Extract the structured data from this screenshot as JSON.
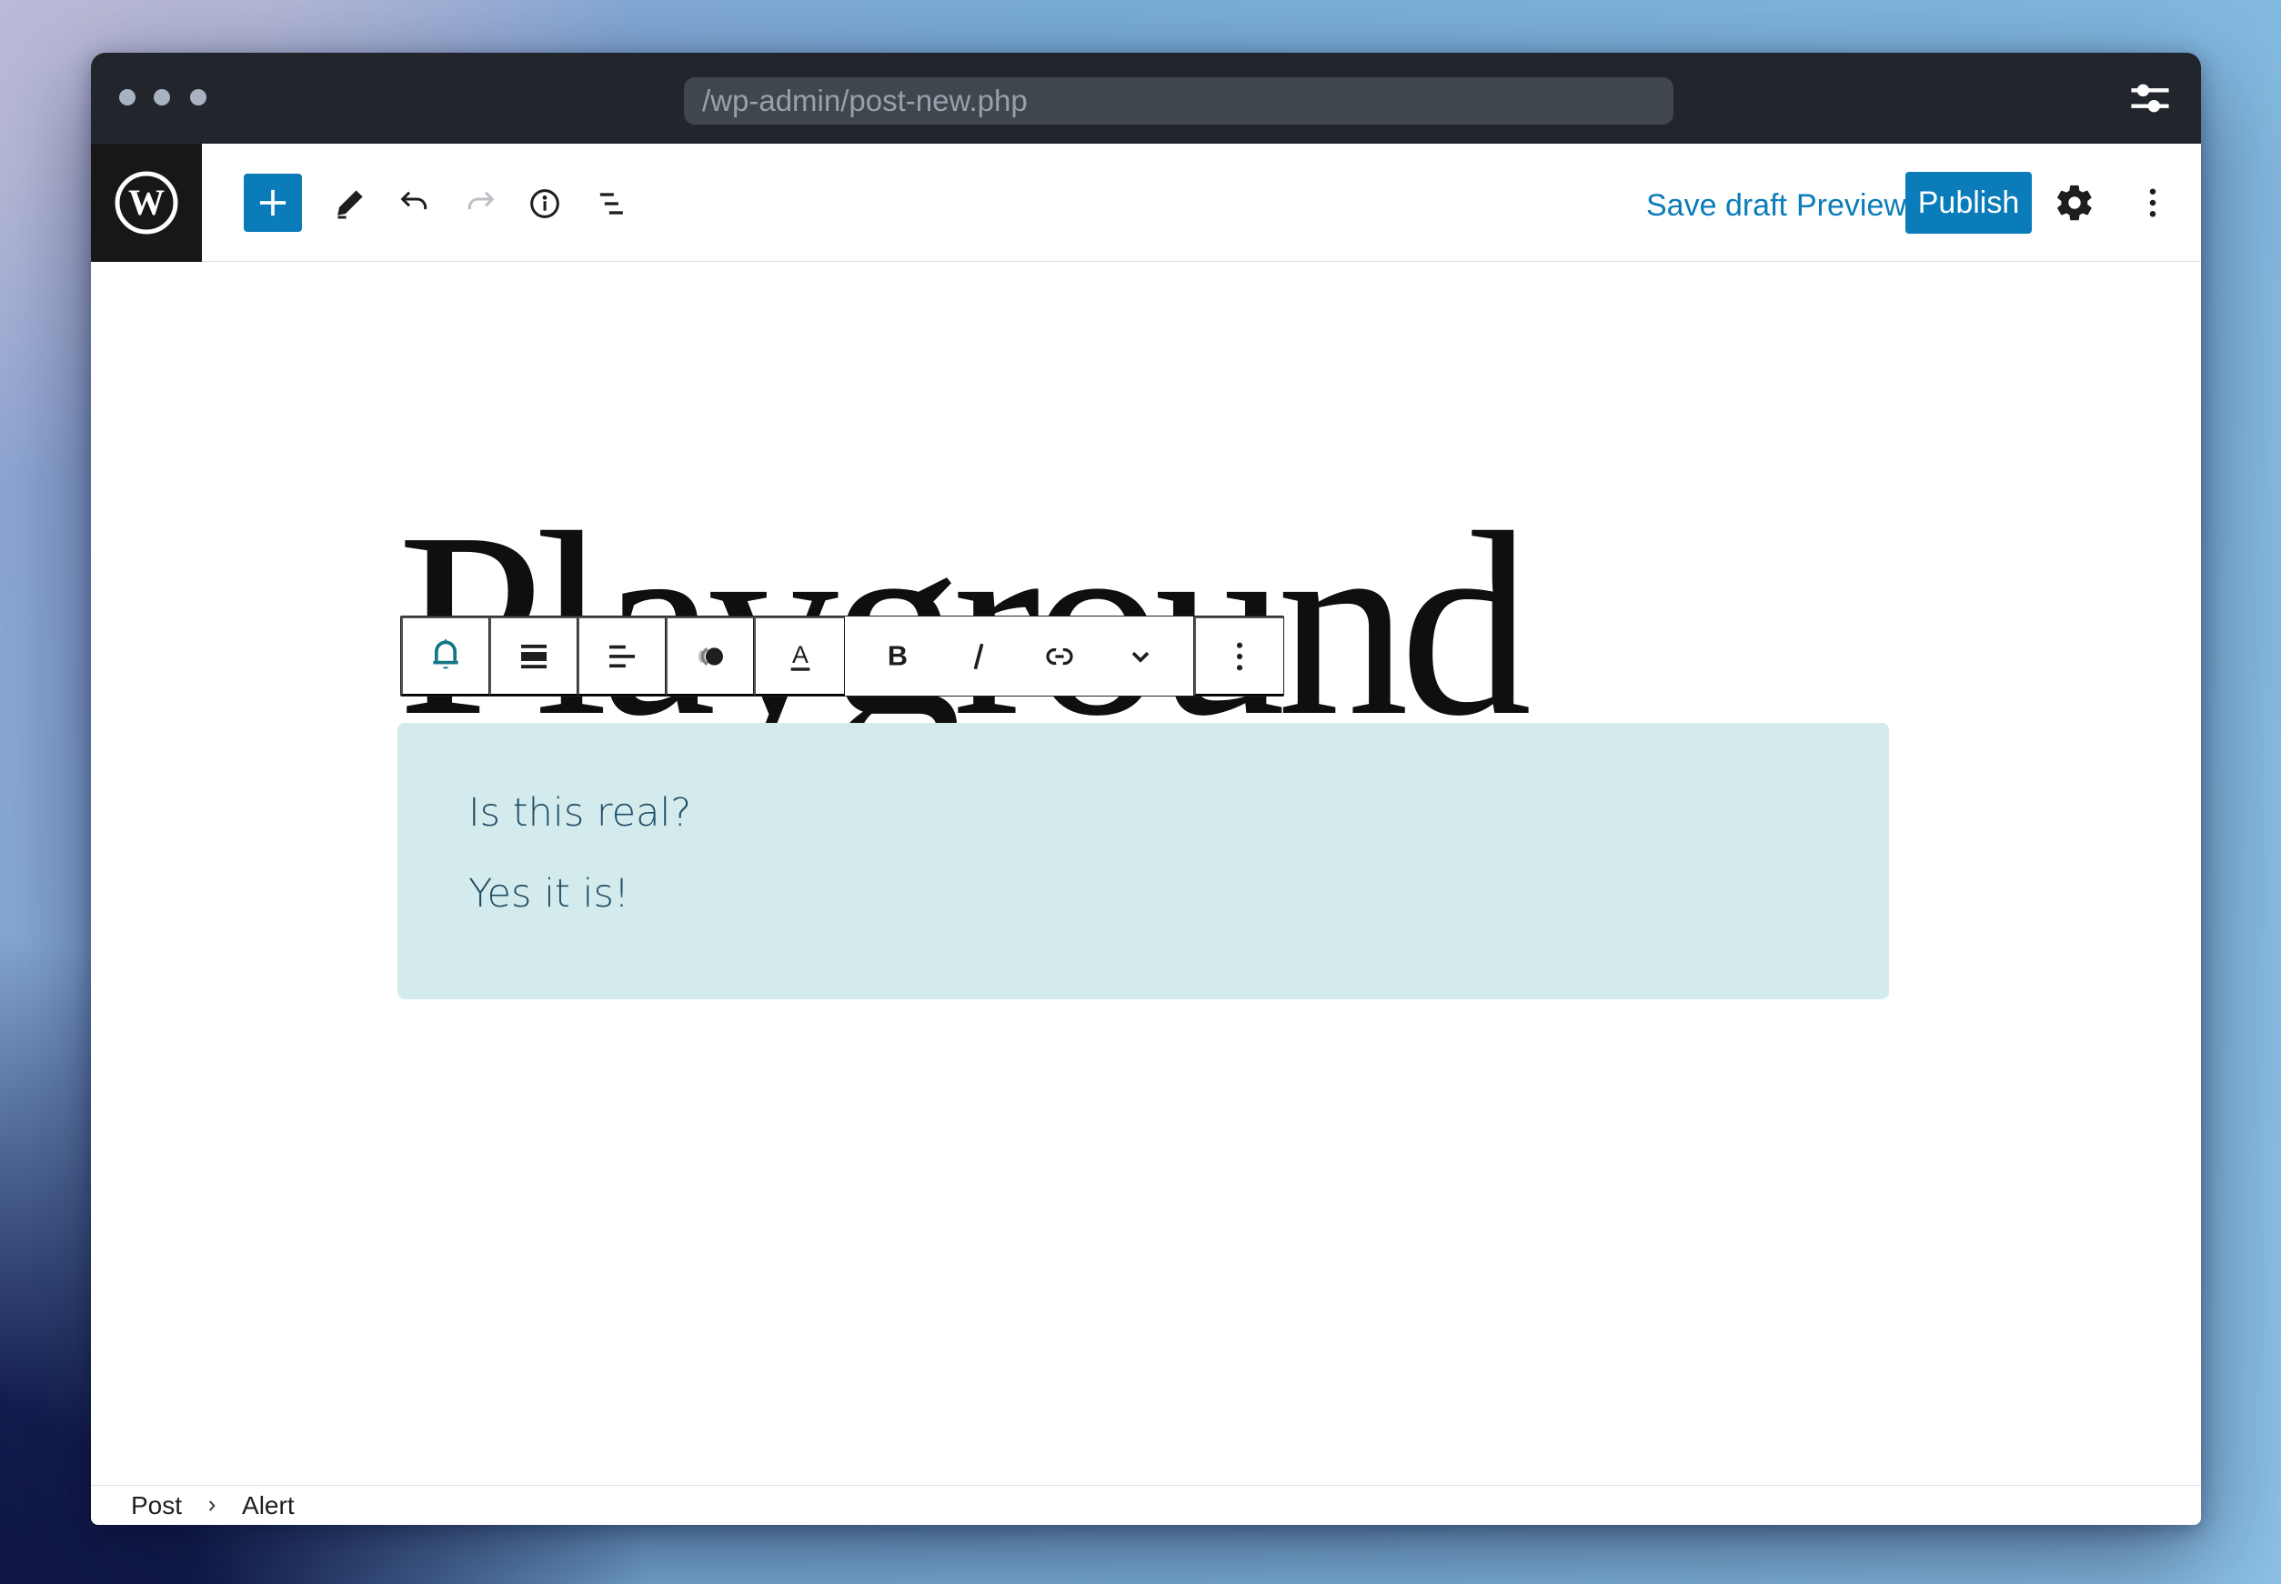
{
  "browser_chrome": {
    "url": "/wp-admin/post-new.php"
  },
  "editor_header": {
    "logo_glyph": "W",
    "save_draft_label": "Save draft",
    "preview_label": "Preview",
    "publish_label": "Publish",
    "tools": [
      "inserter-add-block",
      "edit-pencil",
      "undo",
      "redo-disabled",
      "info-details",
      "list-view"
    ]
  },
  "post": {
    "title": "Playground"
  },
  "block_toolbar": {
    "highlight_glyph": "A",
    "bold_glyph": "B",
    "buttons": [
      "alert-block-bell",
      "align-none",
      "align-text-left",
      "duotone-filter",
      "highlight-text-color",
      "bold",
      "italic",
      "link",
      "more-rich-text",
      "options-kebab"
    ]
  },
  "alert_block": {
    "line1": "Is this real?",
    "line2": "Yes it is!"
  },
  "breadcrumb": {
    "post": "Post",
    "block": "Alert"
  },
  "colors": {
    "accent": "#0a7cba",
    "alert_bg": "#d4ebee",
    "alert_text": "#1f4f66",
    "alert_icon_teal": "#137684",
    "titlebar": "#22262c"
  }
}
